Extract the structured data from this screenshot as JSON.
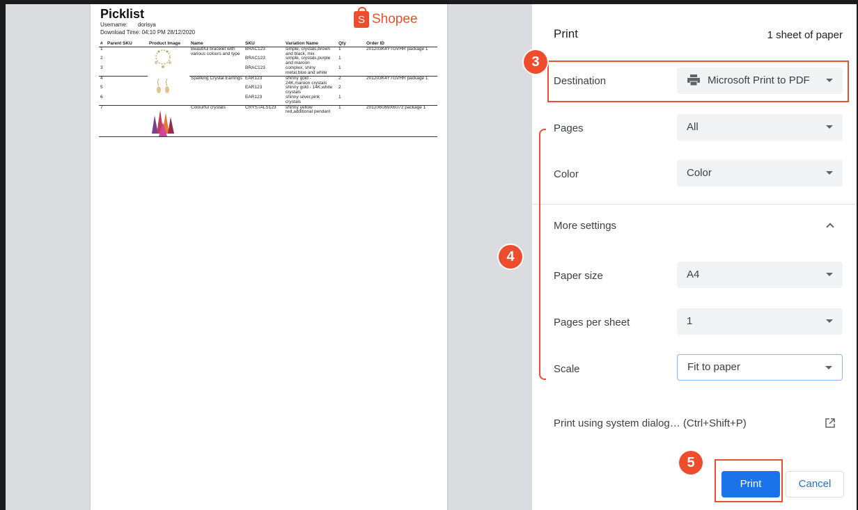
{
  "picklist": {
    "title": "Picklist",
    "username_label": "Username:",
    "username_value": "dorisya",
    "download_time": "Download Time: 04:10 PM 28/12/2020",
    "logo_letter": "S",
    "logo_text": "Shopee",
    "headers": [
      "#",
      "Parent SKU",
      "Product Image",
      "Name",
      "SKU",
      "Variation Name",
      "Qty",
      "Order ID"
    ],
    "rows": [
      {
        "num": "1",
        "parent_sku": "",
        "name": "Beautiful bracelet with various colours and type",
        "sku": "BRAC123",
        "variation": "simple, crystals,brown and black, mix",
        "qty": "1",
        "order_id": "201203K4YTGVHR package 1"
      },
      {
        "num": "2",
        "parent_sku": "",
        "name": "",
        "sku": "BRAC123",
        "variation": "simple, crystals,purple and maroon",
        "qty": "1",
        "order_id": ""
      },
      {
        "num": "3",
        "parent_sku": "",
        "name": "",
        "sku": "BRAC123",
        "variation": "complex, shiny metal,blue and white",
        "qty": "1",
        "order_id": ""
      },
      {
        "num": "4",
        "parent_sku": "",
        "name": "Sparking Crystal Earrings",
        "sku": "EAR123",
        "variation": "shinny gold - 24K,maroon crystals",
        "qty": "2",
        "order_id": "201203K4YTGVHR package 1"
      },
      {
        "num": "5",
        "parent_sku": "",
        "name": "",
        "sku": "EAR123",
        "variation": "shinny gold - 14K,white crystals",
        "qty": "2",
        "order_id": ""
      },
      {
        "num": "6",
        "parent_sku": "",
        "name": "",
        "sku": "EAR123",
        "variation": "shinny silver,pink crystals",
        "qty": "1",
        "order_id": ""
      },
      {
        "num": "7",
        "parent_sku": "",
        "name": "Colourful crystals",
        "sku": "CRYSTALS123",
        "variation": "shinny yellow red,additional pendant",
        "qty": "1",
        "order_id": "201206U69X6U72 package 1"
      }
    ]
  },
  "print": {
    "title": "Print",
    "sheets": "1 sheet of paper",
    "destination_label": "Destination",
    "destination_value": "Microsoft Print to PDF",
    "pages_label": "Pages",
    "pages_value": "All",
    "color_label": "Color",
    "color_value": "Color",
    "more_settings_label": "More settings",
    "paper_size_label": "Paper size",
    "paper_size_value": "A4",
    "pages_per_sheet_label": "Pages per sheet",
    "pages_per_sheet_value": "1",
    "scale_label": "Scale",
    "scale_value": "Fit to paper",
    "system_dialog_label": "Print using system dialog… (Ctrl+Shift+P)",
    "print_button": "Print",
    "cancel_button": "Cancel"
  },
  "annotations": {
    "badge3": "3",
    "badge4": "4",
    "badge5": "5",
    "accent": "#ee4d2d"
  },
  "icons": [
    "printer-icon",
    "dropdown-caret-icon",
    "chevron-up-icon",
    "open-external-icon"
  ]
}
